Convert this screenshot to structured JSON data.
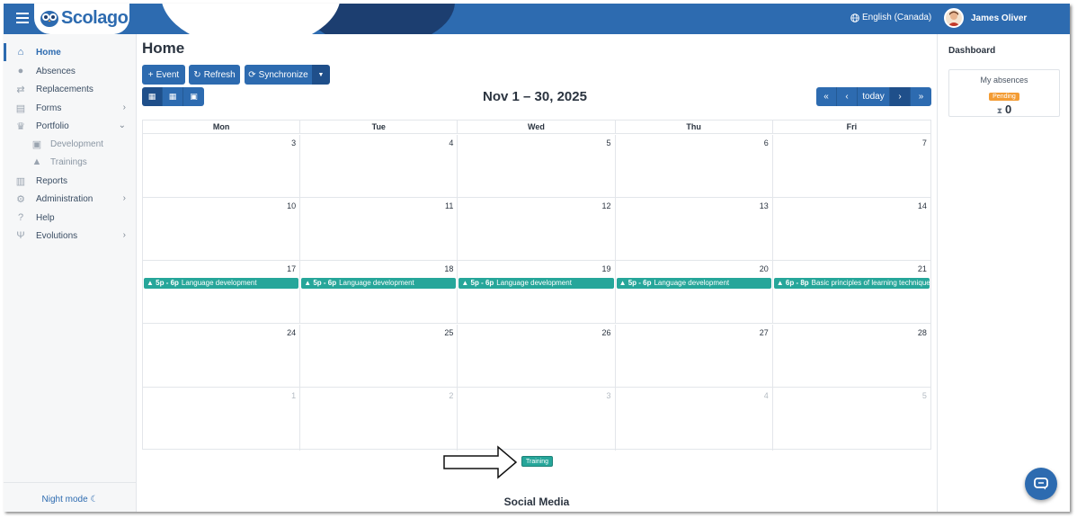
{
  "app": {
    "name": "Scolago"
  },
  "header": {
    "language": "English (Canada)",
    "user_name": "James Oliver"
  },
  "sidebar": {
    "items": [
      {
        "label": "Home",
        "icon": "home-icon",
        "active": true
      },
      {
        "label": "Absences",
        "icon": "absences-icon"
      },
      {
        "label": "Replacements",
        "icon": "replacements-icon"
      },
      {
        "label": "Forms",
        "icon": "forms-icon",
        "chevron": "right"
      },
      {
        "label": "Portfolio",
        "icon": "trophy-icon",
        "chevron": "down"
      },
      {
        "label": "Development",
        "icon": "development-icon",
        "sub": true
      },
      {
        "label": "Trainings",
        "icon": "graduation-cap-icon",
        "sub": true
      },
      {
        "label": "Reports",
        "icon": "reports-icon"
      },
      {
        "label": "Administration",
        "icon": "gear-icon",
        "chevron": "right"
      },
      {
        "label": "Help",
        "icon": "help-icon"
      },
      {
        "label": "Evolutions",
        "icon": "sprout-icon",
        "chevron": "right"
      }
    ],
    "night_mode": "Night mode"
  },
  "main": {
    "title": "Home",
    "toolbar": {
      "event": "Event",
      "refresh": "Refresh",
      "synchronize": "Synchronize"
    },
    "calendar": {
      "title": "Nov 1 – 30, 2025",
      "today": "today",
      "weekdays": [
        "Mon",
        "Tue",
        "Wed",
        "Thu",
        "Fri"
      ],
      "weeks": [
        [
          {
            "d": "3"
          },
          {
            "d": "4"
          },
          {
            "d": "5"
          },
          {
            "d": "6"
          },
          {
            "d": "7"
          }
        ],
        [
          {
            "d": "10"
          },
          {
            "d": "11"
          },
          {
            "d": "12"
          },
          {
            "d": "13"
          },
          {
            "d": "14"
          }
        ],
        [
          {
            "d": "17",
            "time": "5p - 6p",
            "title": "Language development"
          },
          {
            "d": "18",
            "time": "5p - 6p",
            "title": "Language development"
          },
          {
            "d": "19",
            "time": "5p - 6p",
            "title": "Language development"
          },
          {
            "d": "20",
            "time": "5p - 6p",
            "title": "Language development"
          },
          {
            "d": "21",
            "time": "6p - 8p",
            "title": "Basic principles of learning techniques"
          }
        ],
        [
          {
            "d": "24"
          },
          {
            "d": "25"
          },
          {
            "d": "26"
          },
          {
            "d": "27"
          },
          {
            "d": "28"
          }
        ],
        [
          {
            "d": "1",
            "other": true
          },
          {
            "d": "2",
            "other": true
          },
          {
            "d": "3",
            "other": true
          },
          {
            "d": "4",
            "other": true
          },
          {
            "d": "5",
            "other": true
          }
        ]
      ]
    },
    "legend": "Training",
    "social_media": "Social Media"
  },
  "dashboard": {
    "title": "Dashboard",
    "my_absences": "My absences",
    "status": "Pending",
    "count": "0"
  },
  "colors": {
    "primary": "#2d6bb0",
    "dark": "#1f4f8a",
    "event": "#26a69a",
    "pending": "#f39c34"
  }
}
